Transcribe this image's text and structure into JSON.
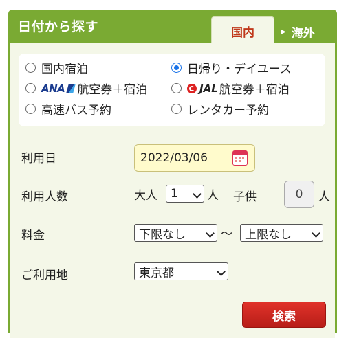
{
  "panel": {
    "title": "日付から探す"
  },
  "tabs": {
    "domestic": "国内",
    "overseas": "海外"
  },
  "options": [
    {
      "label": "国内宿泊",
      "checked": false
    },
    {
      "label": "日帰り・デイユース",
      "checked": true
    },
    {
      "logo": "ANA",
      "label": "航空券＋宿泊",
      "checked": false
    },
    {
      "logo": "JAL",
      "label": "航空券＋宿泊",
      "checked": false
    },
    {
      "label": "高速バス予約",
      "checked": false
    },
    {
      "label": "レンタカー予約",
      "checked": false
    }
  ],
  "form": {
    "date_label": "利用日",
    "date_value": "2022/03/06",
    "people_label": "利用人数",
    "adult_label": "大人",
    "adult_value": "1",
    "person_unit": "人",
    "child_label": "子供",
    "child_value": "0",
    "price_label": "料金",
    "price_min": "下限なし",
    "price_tilde": "〜",
    "price_max": "上限なし",
    "area_label": "ご利用地",
    "area_value": "東京都",
    "search_button": "検索"
  },
  "colors": {
    "panel_green": "#7aaa33",
    "tab_text": "#c0391b",
    "button_red": "#c8241d",
    "date_bg": "#fffbcc"
  }
}
